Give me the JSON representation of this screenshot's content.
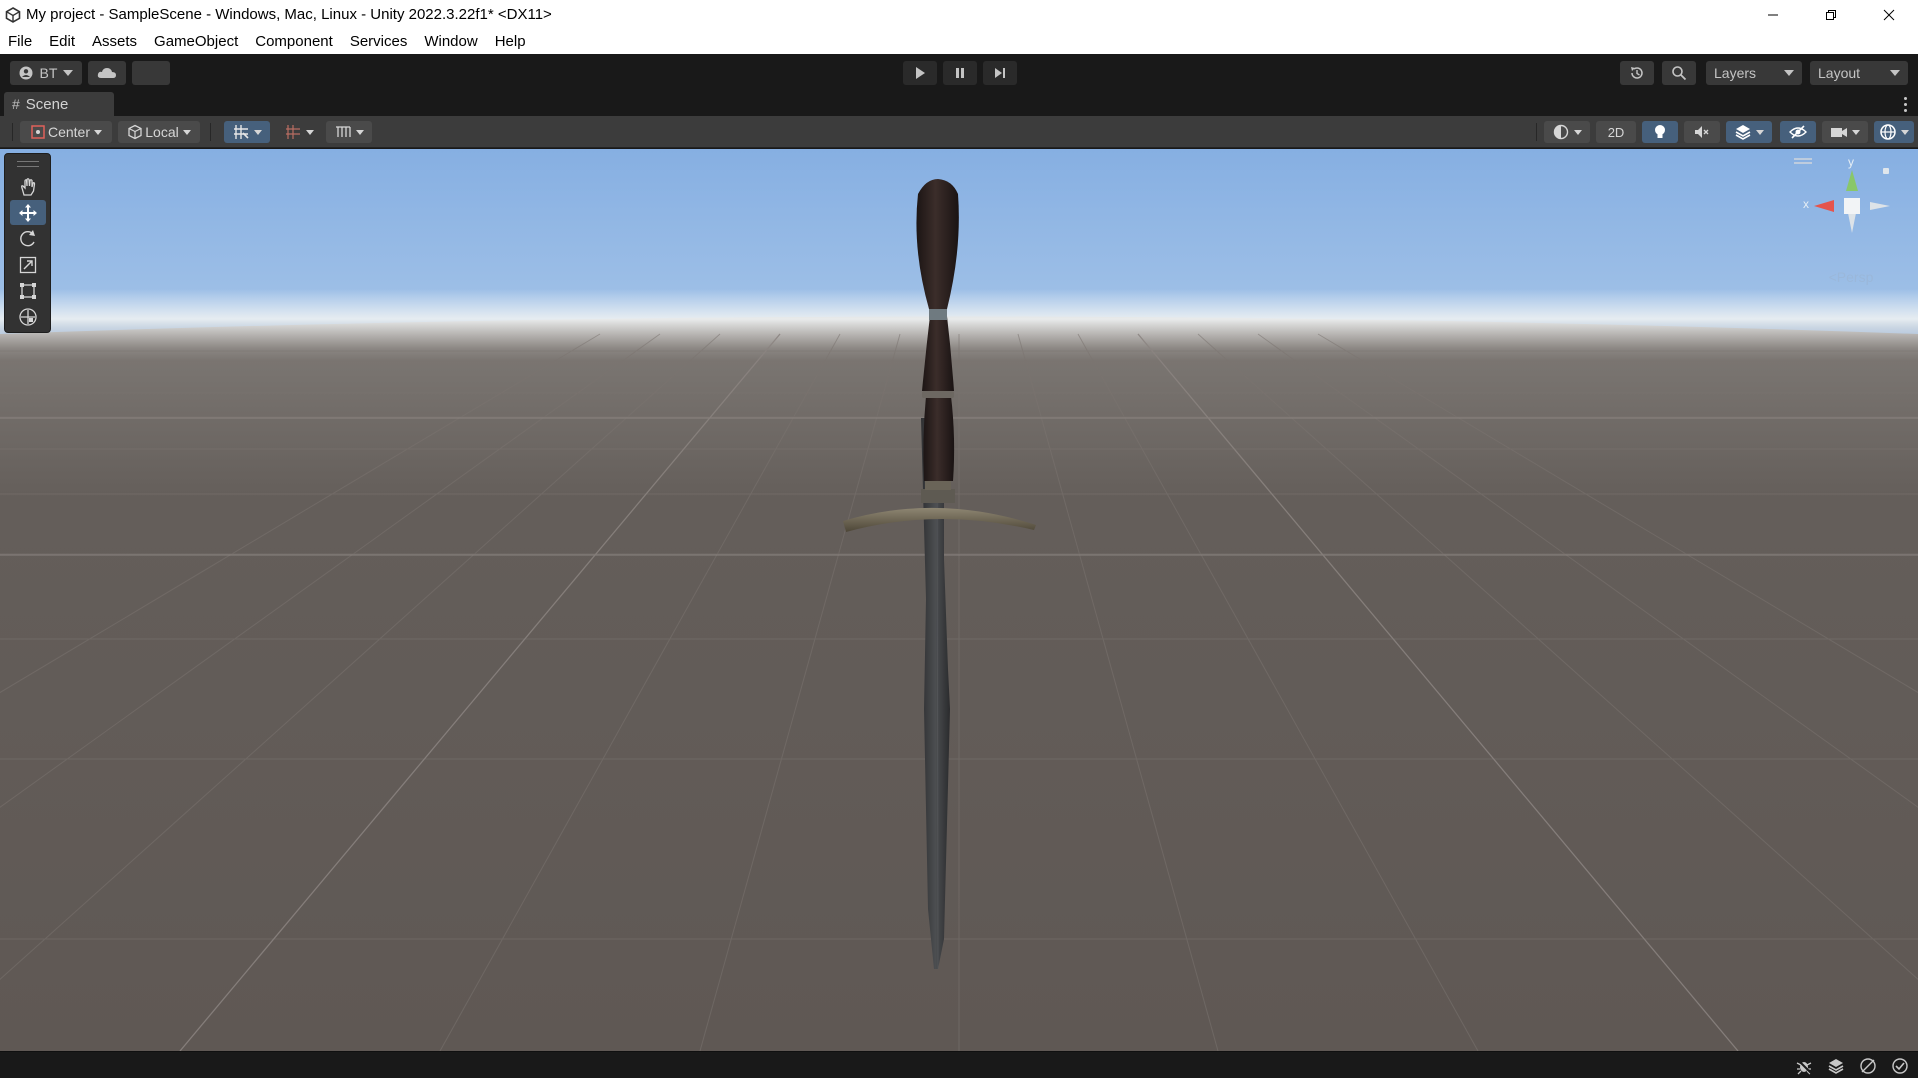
{
  "window": {
    "title": "My project - SampleScene - Windows, Mac, Linux - Unity 2022.3.22f1* <DX11>",
    "controls": {
      "minimize_icon": "minimize-icon",
      "maximize_icon": "restore-icon",
      "close_icon": "close-icon"
    }
  },
  "menu": [
    "File",
    "Edit",
    "Assets",
    "GameObject",
    "Component",
    "Services",
    "Window",
    "Help"
  ],
  "toolbar": {
    "account_label": "BT",
    "layers_label": "Layers",
    "layout_label": "Layout",
    "play_icon": "play-icon",
    "pause_icon": "pause-icon",
    "step_icon": "step-icon"
  },
  "scene_tab": {
    "label": "Scene"
  },
  "scene_toolbar": {
    "pivot_label": "Center",
    "space_label": "Local",
    "view_2d_label": "2D"
  },
  "gizmo": {
    "y_label": "y",
    "x_label": "x",
    "projection_label": "<Persp"
  },
  "colors": {
    "toolbar_bg": "#191919",
    "panel_bg": "#3c3c3c",
    "active_blue": "#46607c",
    "sky_top": "#8ab3e4",
    "horizon": "#f2f6f8",
    "ground": "#5f5854"
  }
}
